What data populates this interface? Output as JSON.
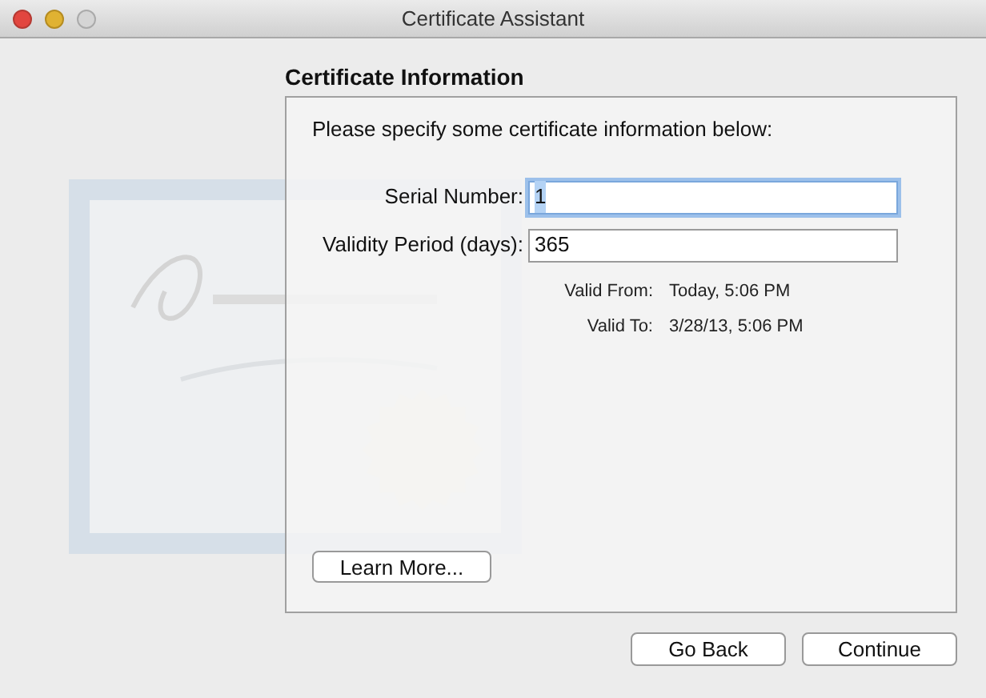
{
  "window": {
    "title": "Certificate Assistant"
  },
  "section": {
    "title": "Certificate Information",
    "prompt": "Please specify some certificate information below:"
  },
  "fields": [
    {
      "label": "Serial Number:",
      "value": "1",
      "focused": true
    },
    {
      "label": "Validity Period (days):",
      "value": "365",
      "focused": false
    }
  ],
  "validity": [
    {
      "label": "Valid From:",
      "value": "Today, 5:06 PM"
    },
    {
      "label": "Valid To:",
      "value": "3/28/13, 5:06 PM"
    }
  ],
  "learn_more": "Learn More...",
  "buttons": [
    "Go Back",
    "Continue"
  ]
}
